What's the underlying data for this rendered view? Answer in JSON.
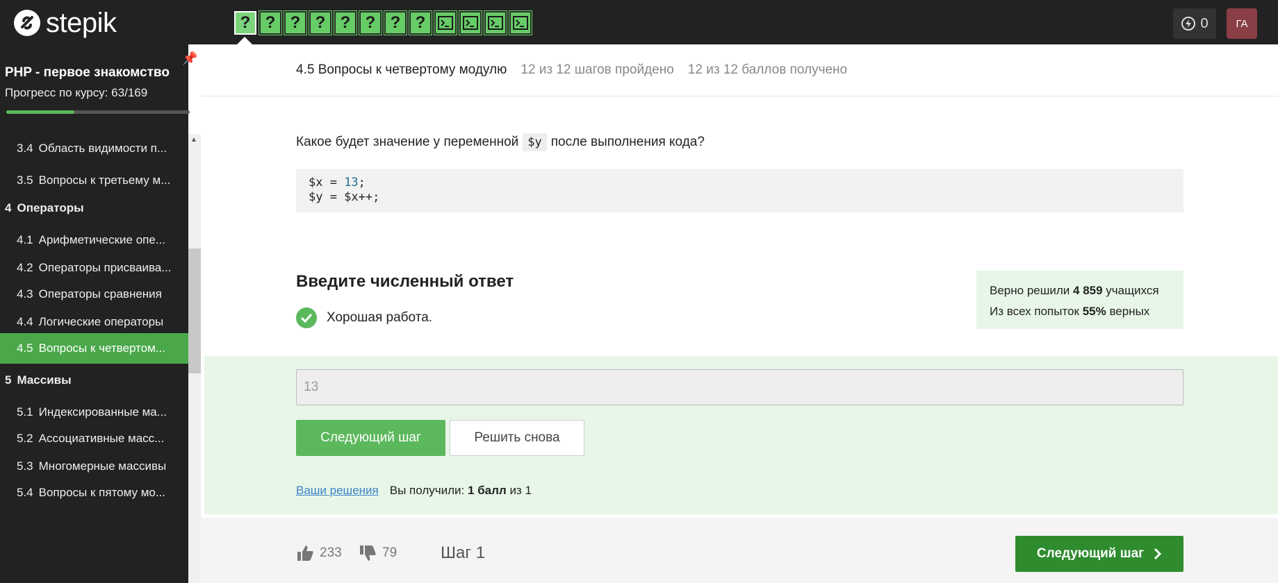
{
  "brand": {
    "name": "stepik"
  },
  "steps": [
    {
      "type": "quiz",
      "glyph": "?"
    },
    {
      "type": "quiz",
      "glyph": "?"
    },
    {
      "type": "quiz",
      "glyph": "?"
    },
    {
      "type": "quiz",
      "glyph": "?"
    },
    {
      "type": "quiz",
      "glyph": "?"
    },
    {
      "type": "quiz",
      "glyph": "?"
    },
    {
      "type": "quiz",
      "glyph": "?"
    },
    {
      "type": "quiz",
      "glyph": "?"
    },
    {
      "type": "code",
      "glyph": "terminal-icon"
    },
    {
      "type": "code",
      "glyph": "terminal-icon"
    },
    {
      "type": "code",
      "glyph": "terminal-icon"
    },
    {
      "type": "code",
      "glyph": "terminal-icon"
    }
  ],
  "header_right": {
    "energy": "0",
    "avatar_initials": "ГА"
  },
  "sidebar": {
    "course_title": "PHP - первое знакомство",
    "progress_label": "Прогресс по курсу:  63/169",
    "progress_fraction": 0.373,
    "items": [
      {
        "kind": "lesson",
        "num": "3.4",
        "label": "Область видимости п..."
      },
      {
        "kind": "lesson",
        "num": "3.5",
        "label": "Вопросы к третьему м..."
      },
      {
        "kind": "section",
        "num": "4",
        "label": "Операторы"
      },
      {
        "kind": "lesson",
        "num": "4.1",
        "label": "Арифметические опе..."
      },
      {
        "kind": "lesson",
        "num": "4.2",
        "label": "Операторы присваива..."
      },
      {
        "kind": "lesson",
        "num": "4.3",
        "label": "Операторы сравнения"
      },
      {
        "kind": "lesson",
        "num": "4.4",
        "label": "Логические операторы"
      },
      {
        "kind": "lesson",
        "num": "4.5",
        "label": "Вопросы к четвертом...",
        "active": true
      },
      {
        "kind": "section",
        "num": "5",
        "label": "Массивы"
      },
      {
        "kind": "lesson",
        "num": "5.1",
        "label": "Индексированные ма..."
      },
      {
        "kind": "lesson",
        "num": "5.2",
        "label": "Ассоциативные масс..."
      },
      {
        "kind": "lesson",
        "num": "5.3",
        "label": "Многомерные массивы"
      },
      {
        "kind": "lesson",
        "num": "5.4",
        "label": "Вопросы к пятому мо..."
      }
    ]
  },
  "lesson_header": {
    "title": "4.5 Вопросы к четвертому модулю",
    "steps_done": "12 из 12 шагов пройдено",
    "points": "12 из 12 баллов  получено"
  },
  "question": {
    "before": "Какое будет значение у переменной",
    "var": "$y",
    "after": "после выполнения кода?",
    "code_line1_prefix": "$x = ",
    "code_line1_num": "13",
    "code_line1_suffix": ";",
    "code_line2": "$y = $x++;"
  },
  "answer": {
    "title": "Введите численный ответ",
    "feedback": "Хорошая работа.",
    "value": "13",
    "next_button": "Следующий шаг",
    "retry_button": "Решить снова",
    "solutions_link": "Ваши решения",
    "result_prefix": "Вы получили:",
    "result_bold": "1 балл",
    "result_suffix": "из 1"
  },
  "stats": {
    "line1_prefix": "Верно решили",
    "line1_bold": "4 859",
    "line1_suffix": "учащихся",
    "line2_prefix": "Из всех попыток",
    "line2_bold": "55%",
    "line2_suffix": "верных"
  },
  "footer": {
    "likes": "233",
    "dislikes": "79",
    "step_label": "Шаг 1",
    "next_button": "Следующий шаг"
  },
  "colors": {
    "accent": "#5cb85c",
    "dark_green": "#2e8b2e",
    "topbar": "#222222",
    "avatar": "#8a3e46"
  }
}
